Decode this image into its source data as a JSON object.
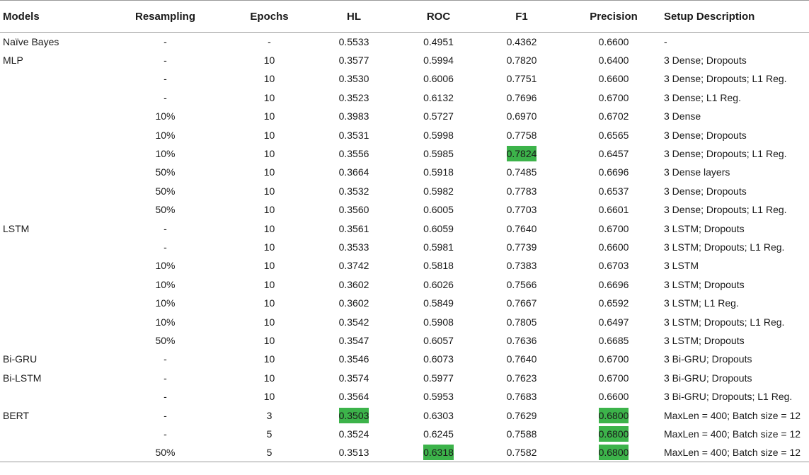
{
  "highlight_color": "#3cb34a",
  "headers": [
    "Models",
    "Resampling",
    "Epochs",
    "HL",
    "ROC",
    "F1",
    "Precision",
    "Setup Description"
  ],
  "rows": [
    [
      "Naïve Bayes",
      "-",
      "-",
      "0.5533",
      "0.4951",
      "0.4362",
      "0.6600",
      "-"
    ],
    [
      "MLP",
      "-",
      "10",
      "0.3577",
      "0.5994",
      "0.7820",
      "0.6400",
      "3 Dense; Dropouts"
    ],
    [
      "",
      "-",
      "10",
      "0.3530",
      "0.6006",
      "0.7751",
      "0.6600",
      "3 Dense; Dropouts; L1 Reg."
    ],
    [
      "",
      "-",
      "10",
      "0.3523",
      "0.6132",
      "0.7696",
      "0.6700",
      "3 Dense; L1 Reg."
    ],
    [
      "",
      "10%",
      "10",
      "0.3983",
      "0.5727",
      "0.6970",
      "0.6702",
      "3 Dense"
    ],
    [
      "",
      "10%",
      "10",
      "0.3531",
      "0.5998",
      "0.7758",
      "0.6565",
      "3 Dense; Dropouts"
    ],
    [
      "",
      "10%",
      "10",
      "0.3556",
      "0.5985",
      "0.7824",
      "0.6457",
      "3 Dense; Dropouts; L1 Reg."
    ],
    [
      "",
      "50%",
      "10",
      "0.3664",
      "0.5918",
      "0.7485",
      "0.6696",
      "3 Dense layers"
    ],
    [
      "",
      "50%",
      "10",
      "0.3532",
      "0.5982",
      "0.7783",
      "0.6537",
      "3 Dense; Dropouts"
    ],
    [
      "",
      "50%",
      "10",
      "0.3560",
      "0.6005",
      "0.7703",
      "0.6601",
      "3 Dense; Dropouts; L1 Reg."
    ],
    [
      "LSTM",
      "-",
      "10",
      "0.3561",
      "0.6059",
      "0.7640",
      "0.6700",
      "3 LSTM; Dropouts"
    ],
    [
      "",
      "-",
      "10",
      "0.3533",
      "0.5981",
      "0.7739",
      "0.6600",
      "3 LSTM; Dropouts; L1 Reg."
    ],
    [
      "",
      "10%",
      "10",
      "0.3742",
      "0.5818",
      "0.7383",
      "0.6703",
      "3 LSTM"
    ],
    [
      "",
      "10%",
      "10",
      "0.3602",
      "0.6026",
      "0.7566",
      "0.6696",
      "3 LSTM; Dropouts"
    ],
    [
      "",
      "10%",
      "10",
      "0.3602",
      "0.5849",
      "0.7667",
      "0.6592",
      "3 LSTM; L1 Reg."
    ],
    [
      "",
      "10%",
      "10",
      "0.3542",
      "0.5908",
      "0.7805",
      "0.6497",
      "3 LSTM; Dropouts; L1 Reg."
    ],
    [
      "",
      "50%",
      "10",
      "0.3547",
      "0.6057",
      "0.7636",
      "0.6685",
      "3 LSTM; Dropouts"
    ],
    [
      "Bi-GRU",
      "-",
      "10",
      "0.3546",
      "0.6073",
      "0.7640",
      "0.6700",
      "3 Bi-GRU; Dropouts"
    ],
    [
      "Bi-LSTM",
      "-",
      "10",
      "0.3574",
      "0.5977",
      "0.7623",
      "0.6700",
      "3 Bi-GRU; Dropouts"
    ],
    [
      "",
      "-",
      "10",
      "0.3564",
      "0.5953",
      "0.7683",
      "0.6600",
      "3 Bi-GRU; Dropouts; L1 Reg."
    ],
    [
      "BERT",
      "-",
      "3",
      "0.3503",
      "0.6303",
      "0.7629",
      "0.6800",
      "MaxLen = 400; Batch size = 12"
    ],
    [
      "",
      "-",
      "5",
      "0.3524",
      "0.6245",
      "0.7588",
      "0.6800",
      "MaxLen = 400; Batch size = 12"
    ],
    [
      "",
      "50%",
      "5",
      "0.3513",
      "0.6318",
      "0.7582",
      "0.6800",
      "MaxLen = 400; Batch size = 12"
    ]
  ],
  "highlighted_cells": [
    [
      6,
      5
    ],
    [
      20,
      3
    ],
    [
      20,
      6
    ],
    [
      21,
      6
    ],
    [
      22,
      4
    ],
    [
      22,
      6
    ]
  ]
}
